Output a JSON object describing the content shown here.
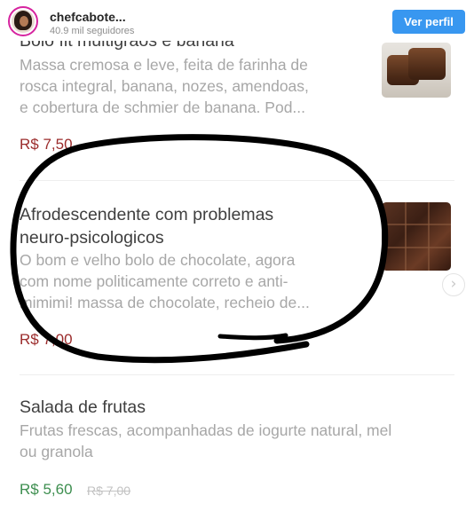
{
  "header": {
    "username": "chefcabote...",
    "followers": "40.9 mil seguidores",
    "follow_button": "Ver perfil"
  },
  "menu": {
    "items": [
      {
        "title": "Bolo fit multigrãos e banana",
        "description": [
          "Massa cremosa e leve, feita de farinha de",
          "rosca integral, banana, nozes, amendoas,",
          "e cobertura de schmier de banana. Pod..."
        ],
        "price": "R$ 7,50"
      },
      {
        "title": [
          "Afrodescendente com problemas",
          "neuro-psicologicos"
        ],
        "description": [
          "O bom e velho bolo de chocolate, agora",
          "com nome politicamente correto e anti-",
          "mimimi! massa de chocolate, recheio de..."
        ],
        "price": "R$ 7,00"
      },
      {
        "title": "Salada de frutas",
        "description": [
          "Frutas frescas, acompanhadas de iogurte natural, mel",
          "ou granola"
        ],
        "price": "R$ 5,60",
        "old_price": "R$ 7,00"
      }
    ]
  },
  "colors": {
    "follow_button": "#3897f0",
    "price_red": "#9b2c2c",
    "price_green": "#3d8e4f",
    "annotation_ink": "#000000"
  },
  "icons": {
    "carousel_next": "chevron-right-icon"
  }
}
